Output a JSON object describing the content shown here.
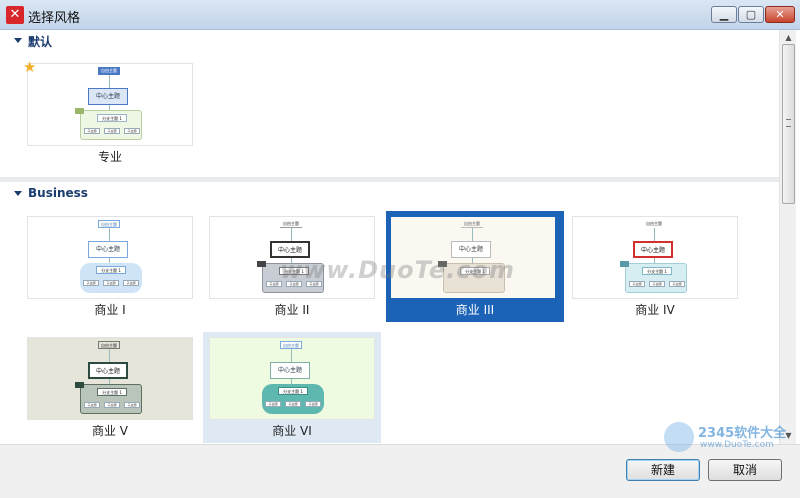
{
  "window": {
    "title": "选择风格",
    "min_label": "▁",
    "max_label": "▢",
    "close_label": "✕"
  },
  "sections": [
    {
      "label": "默认"
    },
    {
      "label": "Business"
    }
  ],
  "themes": {
    "pro": {
      "label": "专业",
      "center": "中心主题",
      "top": "自由主题",
      "sub": "分支主题 1",
      "leaf": "子主题"
    },
    "b1": {
      "label": "商业 I",
      "center": "中心主题",
      "top": "自由主题",
      "sub": "分支主题 1",
      "leaf": "子主题"
    },
    "b2": {
      "label": "商业 II",
      "center": "中心主题",
      "top": "自由主题",
      "sub": "分支主题 1",
      "leaf": "子主题"
    },
    "b3": {
      "label": "商业 III",
      "center": "中心主题",
      "top": "自由主题",
      "sub": "分支主题 1",
      "leaf": "子主题"
    },
    "b4": {
      "label": "商业 IV",
      "center": "中心主题",
      "top": "自由主题",
      "sub": "分支主题 1",
      "leaf": "子主题"
    },
    "b5": {
      "label": "商业 V",
      "center": "中心主题",
      "top": "自由主题",
      "sub": "分支主题 1",
      "leaf": "子主题"
    },
    "b6": {
      "label": "商业 VI",
      "center": "中心主题",
      "top": "自由主题",
      "sub": "分支主题 1",
      "leaf": "子主题"
    }
  },
  "selected_theme": "商业 III",
  "buttons": {
    "new": "新建",
    "cancel": "取消"
  },
  "watermark": {
    "text": "www.DuoTe.com",
    "logo_text": "2345软件大全",
    "logo_url": "www.DuoTe.com"
  },
  "colors": {
    "accent": "#1c63b7",
    "title_bar": "#c2d4ea",
    "section_text": "#1a3c6e"
  }
}
